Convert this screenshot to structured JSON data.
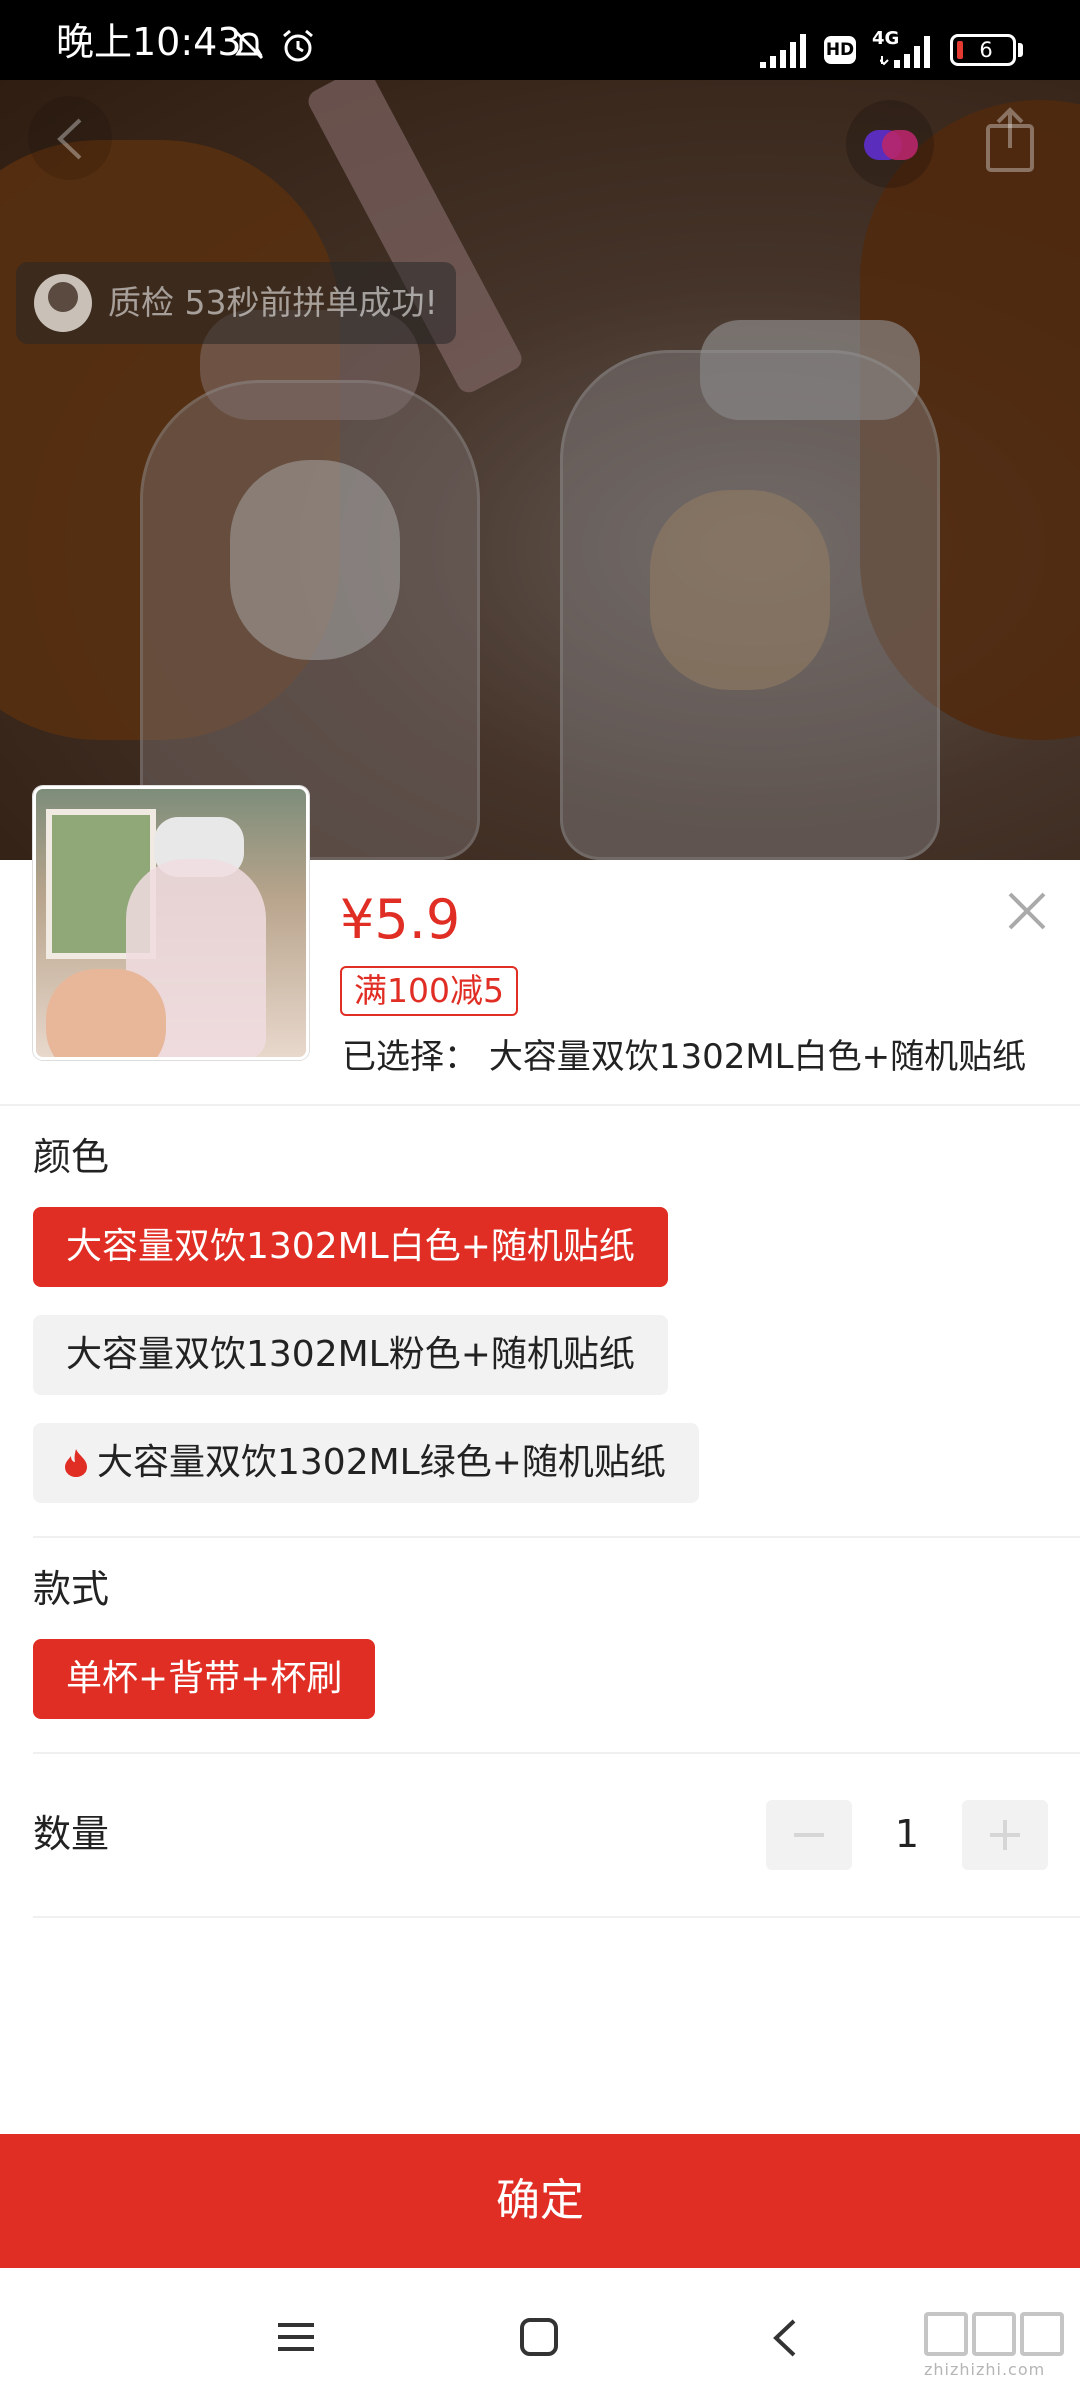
{
  "status_bar": {
    "time": "晚上10:43",
    "network": "4G",
    "hd": "HD",
    "battery": "6"
  },
  "toast": {
    "text": "质检 53秒前拼单成功!"
  },
  "product": {
    "price": "¥5.9",
    "promo": "满100减5",
    "selected_prefix": "已选择：",
    "selected_value": "大容量双饮1302ML白色+随机贴纸"
  },
  "color_section": {
    "title": "颜色",
    "options": [
      {
        "label": "大容量双饮1302ML白色+随机贴纸",
        "selected": true,
        "hot": false
      },
      {
        "label": "大容量双饮1302ML粉色+随机贴纸",
        "selected": false,
        "hot": false
      },
      {
        "label": "大容量双饮1302ML绿色+随机贴纸",
        "selected": false,
        "hot": true
      }
    ]
  },
  "style_section": {
    "title": "款式",
    "options": [
      {
        "label": "单杯+背带+杯刷",
        "selected": true
      }
    ]
  },
  "quantity": {
    "label": "数量",
    "value": "1"
  },
  "confirm_label": "确定",
  "watermark": "zhizhizhi.com",
  "colors": {
    "accent": "#e02e24",
    "option_bg": "#f2f2f2"
  }
}
